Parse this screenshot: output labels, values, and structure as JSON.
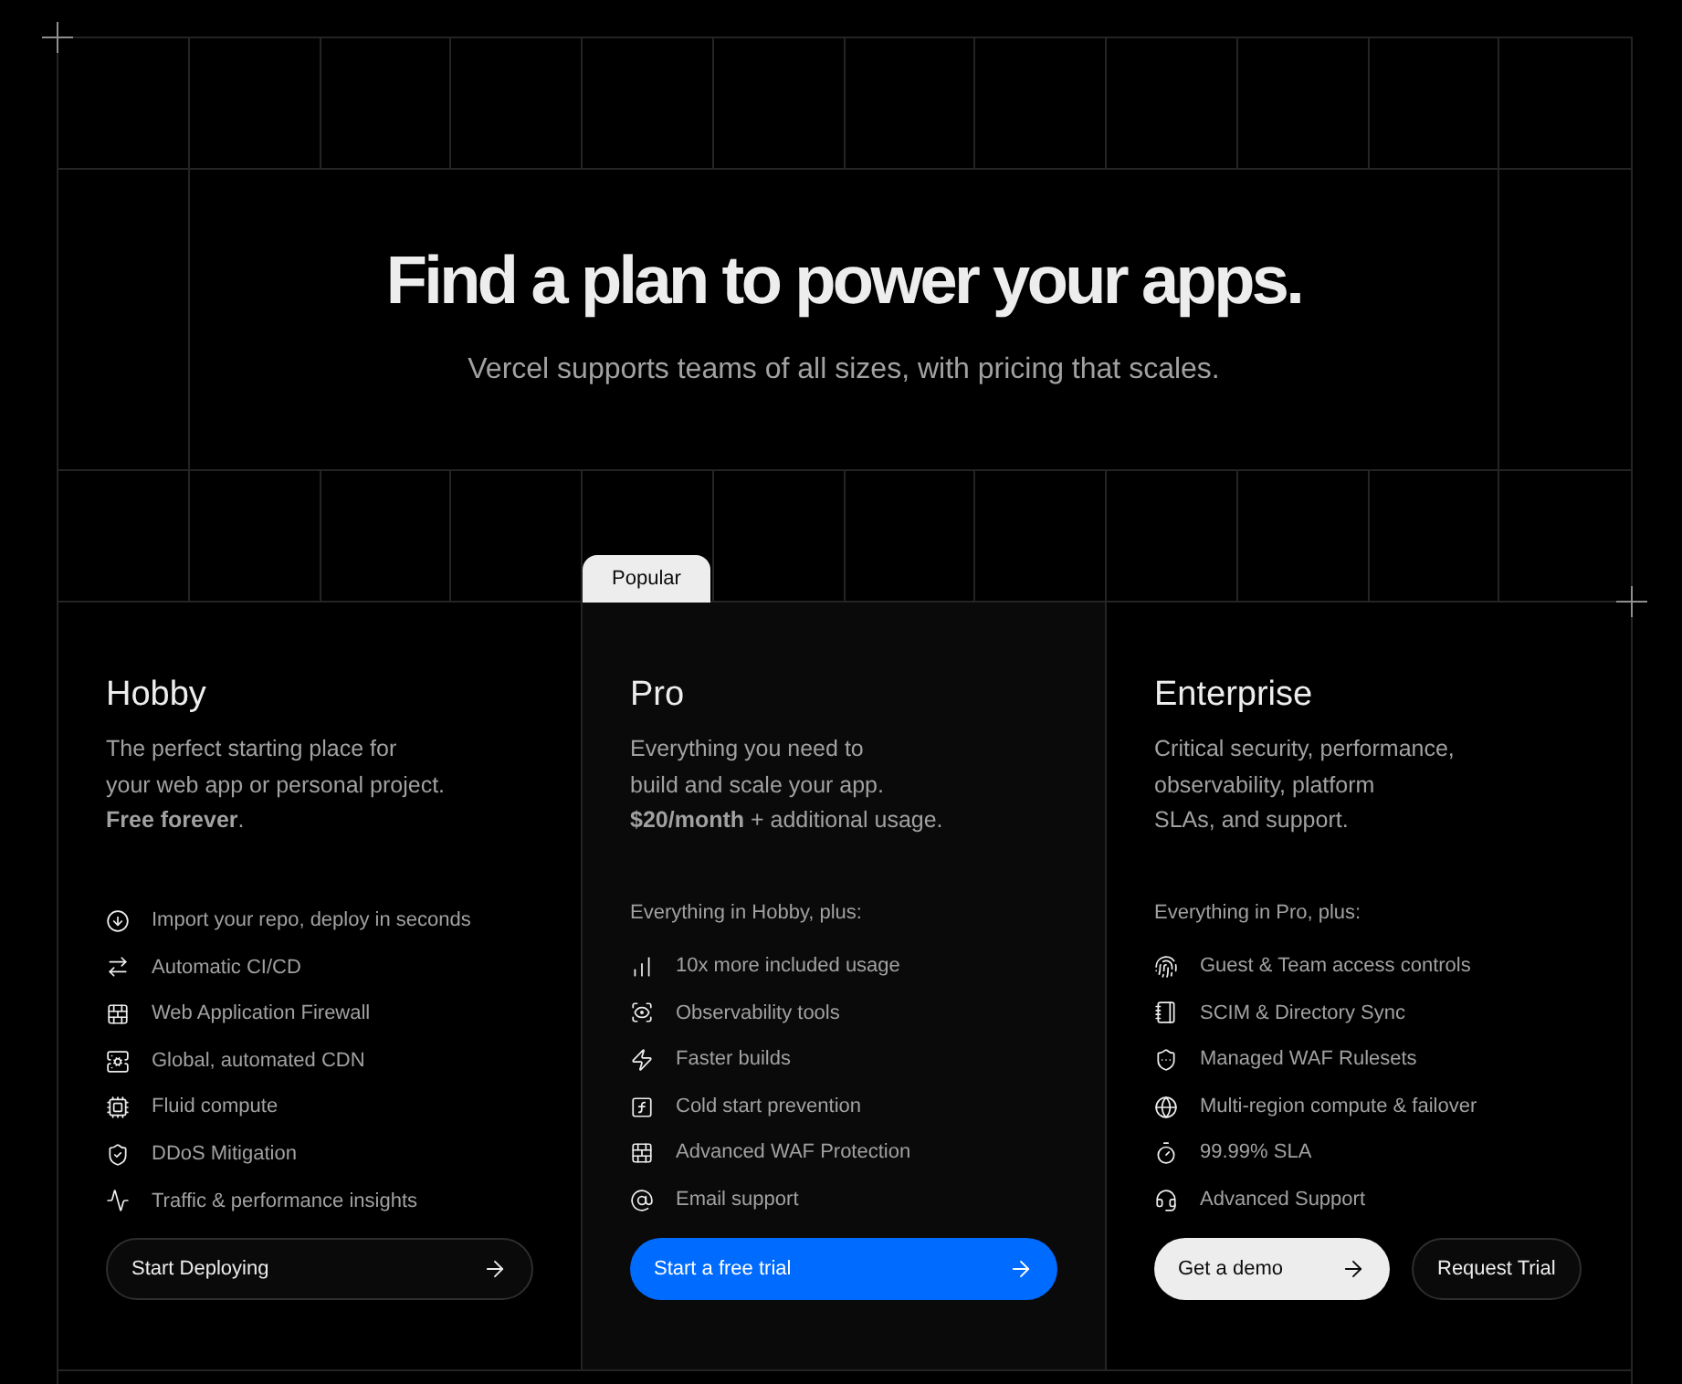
{
  "hero": {
    "title": "Find a plan to power your apps.",
    "subtitle": "Vercel supports teams of all sizes, with pricing that scales."
  },
  "plans": [
    {
      "name": "Hobby",
      "featured": false,
      "description": "The perfect starting place for\nyour web app or personal project.\n**Free forever**.",
      "features": [
        "Import your repo, deploy in seconds",
        "Automatic CI/CD",
        "Web Application Firewall",
        "Global, automated CDN",
        "Fluid compute",
        "DDoS Mitigation",
        "Traffic & performance insights"
      ],
      "buttons": [
        {
          "label": "Start Deploying",
          "kind": "dark",
          "arrow": true
        }
      ]
    },
    {
      "name": "Pro",
      "featured": true,
      "badge": "Popular",
      "description": "Everything you need to\nbuild and scale your app.\n**$20/month** + additional usage.",
      "intro": "Everything in Hobby, plus:",
      "features": [
        "10x more included usage",
        "Observability tools",
        "Faster builds",
        "Cold start prevention",
        "Advanced WAF Protection",
        "Email support"
      ],
      "buttons": [
        {
          "label": "Start a free trial",
          "kind": "primary",
          "arrow": true
        }
      ]
    },
    {
      "name": "Enterprise",
      "featured": false,
      "description": "Critical security, performance,\nobservability, platform\nSLAs, and support.",
      "intro": "Everything in Pro, plus:",
      "features": [
        "Guest & Team access controls",
        "SCIM & Directory Sync",
        "Managed WAF Rulesets",
        "Multi-region compute & failover",
        "99.99% SLA",
        "Advanced Support"
      ],
      "buttons": [
        {
          "label": "Get a demo",
          "kind": "light",
          "arrow": true
        },
        {
          "label": "Request Trial",
          "kind": "dark",
          "arrow": false
        }
      ]
    }
  ]
}
